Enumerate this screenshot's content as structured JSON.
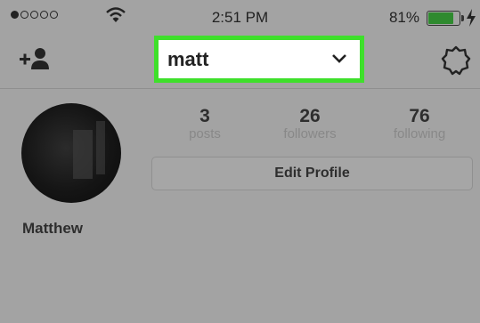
{
  "status_bar": {
    "signal_dots_filled": 1,
    "signal_dots_total": 5,
    "time": "2:51 PM",
    "battery_percent": "81%",
    "icons": [
      "signal-dots-icon",
      "wifi-icon",
      "battery-icon",
      "charging-icon"
    ]
  },
  "header": {
    "username": "matt",
    "icons": [
      "add-user-icon",
      "chevron-down-icon",
      "settings-gear-icon"
    ],
    "highlight_color": "#3ee02b"
  },
  "profile": {
    "stats": [
      {
        "value": "3",
        "label": "posts"
      },
      {
        "value": "26",
        "label": "followers"
      },
      {
        "value": "76",
        "label": "following"
      }
    ],
    "edit_button_label": "Edit Profile",
    "full_name": "Matthew"
  },
  "colors": {
    "overlay_background": "#a3a3a3",
    "battery_fill": "#2f8a2f"
  }
}
